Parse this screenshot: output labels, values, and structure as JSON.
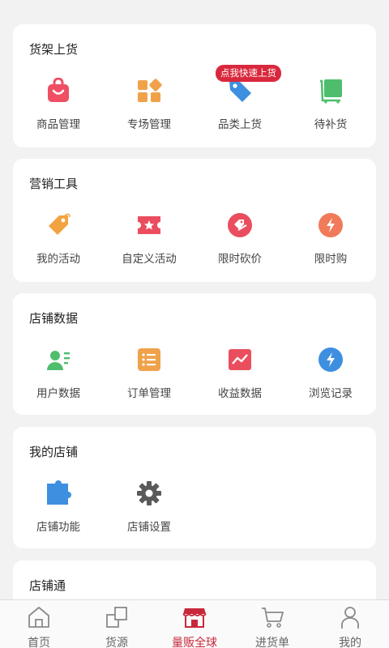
{
  "sections": [
    {
      "title": "货架上货",
      "items": [
        {
          "label": "商品管理",
          "icon": "shopping-bag-icon"
        },
        {
          "label": "专场管理",
          "icon": "grid-blocks-icon"
        },
        {
          "label": "品类上货",
          "icon": "price-tag-icon",
          "badge": "点我快速上货"
        },
        {
          "label": "待补货",
          "icon": "cart-board-icon"
        }
      ]
    },
    {
      "title": "营销工具",
      "items": [
        {
          "label": "我的活动",
          "icon": "tag-icon"
        },
        {
          "label": "自定义活动",
          "icon": "ticket-star-icon"
        },
        {
          "label": "限时砍价",
          "icon": "discount-icon"
        },
        {
          "label": "限时购",
          "icon": "lightning-icon"
        }
      ]
    },
    {
      "title": "店铺数据",
      "items": [
        {
          "label": "用户数据",
          "icon": "user-card-icon"
        },
        {
          "label": "订单管理",
          "icon": "list-icon"
        },
        {
          "label": "收益数据",
          "icon": "chart-icon"
        },
        {
          "label": "浏览记录",
          "icon": "lightning-circle-icon"
        }
      ]
    },
    {
      "title": "我的店铺",
      "items": [
        {
          "label": "店铺功能",
          "icon": "puzzle-icon"
        },
        {
          "label": "店铺设置",
          "icon": "gear-icon"
        }
      ]
    },
    {
      "title": "店铺通",
      "items": []
    }
  ],
  "tabbar": [
    {
      "label": "首页",
      "icon": "home-icon",
      "active": false
    },
    {
      "label": "货源",
      "icon": "source-icon",
      "active": false
    },
    {
      "label": "量贩全球",
      "icon": "store-icon",
      "active": true
    },
    {
      "label": "进货单",
      "icon": "cart-icon",
      "active": false
    },
    {
      "label": "我的",
      "icon": "person-icon",
      "active": false
    }
  ],
  "colors": {
    "accent": "#c8283a",
    "badge": "#d9283d",
    "background": "#f2f2f2"
  }
}
